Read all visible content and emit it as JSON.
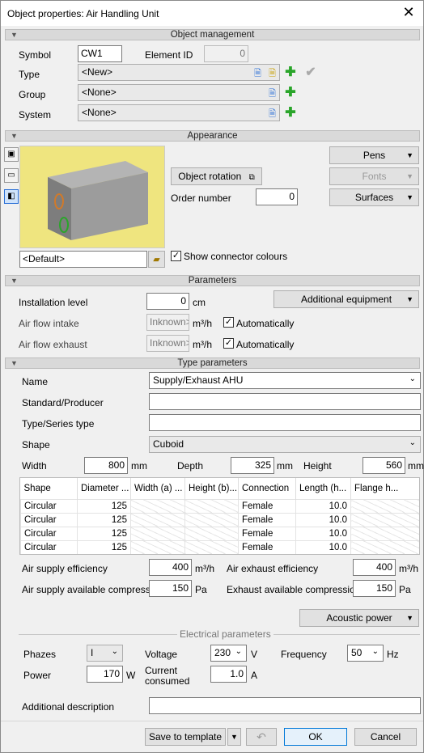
{
  "title": "Object properties: Air Handling Unit",
  "sections": {
    "object_management": "Object management",
    "appearance": "Appearance",
    "parameters": "Parameters",
    "type_parameters": "Type parameters",
    "electrical": "Electrical parameters"
  },
  "om": {
    "symbol_label": "Symbol",
    "symbol_value": "CW1",
    "element_id_label": "Element ID",
    "element_id_value": "0",
    "type_label": "Type",
    "type_value": "<New>",
    "group_label": "Group",
    "group_value": "<None>",
    "system_label": "System",
    "system_value": "<None>"
  },
  "appearance": {
    "object_rotation": "Object rotation",
    "order_number_label": "Order number",
    "order_number_value": "0",
    "pens": "Pens",
    "fonts": "Fonts",
    "surfaces": "Surfaces",
    "style_value": "<Default>",
    "show_connector_colours": "Show connector colours"
  },
  "parameters": {
    "installation_level_label": "Installation level",
    "installation_level_value": "0",
    "installation_level_unit": "cm",
    "additional_equipment": "Additional equipment",
    "air_flow_intake_label": "Air flow intake",
    "air_flow_intake_value": "Inknown>",
    "air_flow_intake_unit": "m³/h",
    "air_flow_exhaust_label": "Air flow exhaust",
    "air_flow_exhaust_value": "Inknown>",
    "air_flow_exhaust_unit": "m³/h",
    "automatically": "Automatically"
  },
  "type": {
    "name_label": "Name",
    "name_value": "Supply/Exhaust AHU",
    "standard_label": "Standard/Producer",
    "standard_value": "",
    "series_label": "Type/Series type",
    "series_value": "",
    "shape_label": "Shape",
    "shape_value": "Cuboid",
    "width_label": "Width",
    "width_value": "800",
    "width_unit": "mm",
    "depth_label": "Depth",
    "depth_value": "325",
    "depth_unit": "mm",
    "height_label": "Height",
    "height_value": "560",
    "height_unit": "mm",
    "columns": [
      "Shape",
      "Diameter ...",
      "Width (a) ...",
      "Height (b)...",
      "Connection",
      "Length (h...",
      "Flange h..."
    ],
    "rows": [
      [
        "Circular",
        "125",
        "",
        "",
        "Female",
        "10.0",
        ""
      ],
      [
        "Circular",
        "125",
        "",
        "",
        "Female",
        "10.0",
        ""
      ],
      [
        "Circular",
        "125",
        "",
        "",
        "Female",
        "10.0",
        ""
      ],
      [
        "Circular",
        "125",
        "",
        "",
        "Female",
        "10.0",
        ""
      ]
    ],
    "air_supply_eff_label": "Air supply efficiency",
    "air_supply_eff_value": "400",
    "air_supply_eff_unit": "m³/h",
    "air_exhaust_eff_label": "Air exhaust efficiency",
    "air_exhaust_eff_value": "400",
    "air_exhaust_eff_unit": "m³/h",
    "supply_comp_label": "Air supply available compression",
    "supply_comp_value": "150",
    "supply_comp_unit": "Pa",
    "exhaust_comp_label": "Exhaust available compression",
    "exhaust_comp_value": "150",
    "exhaust_comp_unit": "Pa",
    "acoustic_power": "Acoustic power"
  },
  "electrical": {
    "phazes_label": "Phazes",
    "phazes_value": "I",
    "voltage_label": "Voltage",
    "voltage_value": "230",
    "voltage_unit": "V",
    "frequency_label": "Frequency",
    "frequency_value": "50",
    "frequency_unit": "Hz",
    "power_label": "Power",
    "power_value": "170",
    "power_unit": "W",
    "current_label_1": "Current",
    "current_label_2": "consumed",
    "current_value": "1.0",
    "current_unit": "A"
  },
  "additional_description_label": "Additional description",
  "footer": {
    "save_template": "Save to template",
    "ok": "OK",
    "cancel": "Cancel"
  },
  "colors": {
    "preview_bg": "#efe57f",
    "add_green": "#2aa52a"
  }
}
